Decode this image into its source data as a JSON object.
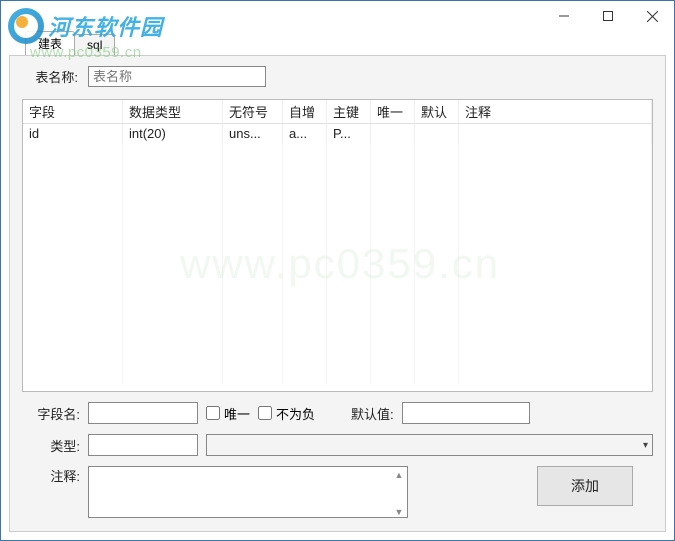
{
  "watermark": {
    "brand": "河东软件园",
    "url": "www.pc0359.cn"
  },
  "tabs": {
    "builder": "建表",
    "sql": "sql"
  },
  "form": {
    "tablename_label": "表名称:",
    "tablename_placeholder": "表名称"
  },
  "grid": {
    "headers": [
      "字段",
      "数据类型",
      "无符号",
      "自增",
      "主键",
      "唯一",
      "默认",
      "注释"
    ],
    "rows": [
      {
        "field": "id",
        "datatype": "int(20)",
        "unsigned": "uns...",
        "autoinc": "a...",
        "pk": "P...",
        "unique": "",
        "default": "",
        "comment": ""
      }
    ]
  },
  "bottom": {
    "fieldname_label": "字段名:",
    "unique_label": "唯一",
    "notneg_label": "不为负",
    "default_label": "默认值:",
    "type_label": "类型:",
    "comment_label": "注释:"
  },
  "buttons": {
    "add": "添加"
  }
}
